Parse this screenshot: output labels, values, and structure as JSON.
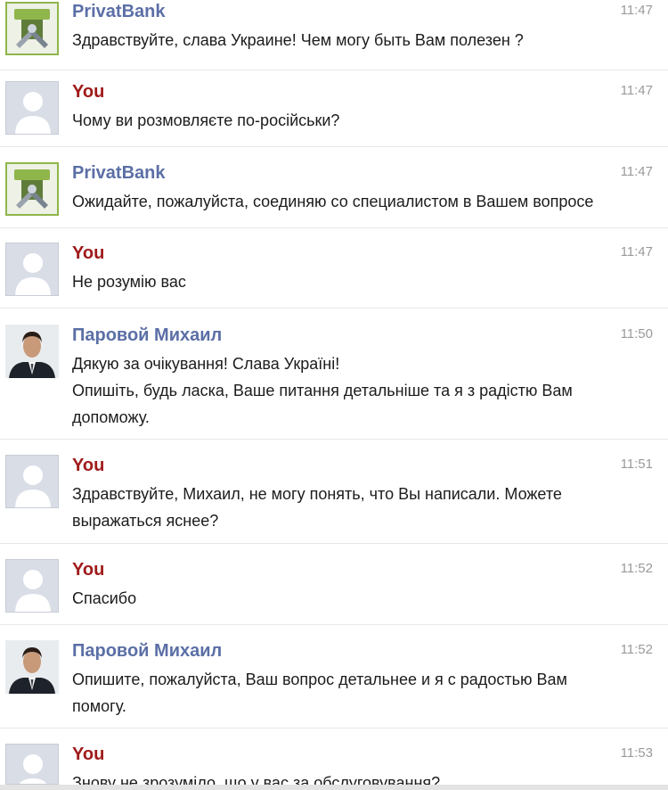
{
  "messages": [
    {
      "sender": "PrivatBank",
      "type": "bank",
      "time": "11:47",
      "lines": [
        "Здравствуйте, слава Украине! Чем могу быть Вам полезен ?"
      ]
    },
    {
      "sender": "You",
      "type": "user",
      "time": "11:47",
      "lines": [
        "Чому ви розмовляєте по-російськи?"
      ]
    },
    {
      "sender": "PrivatBank",
      "type": "bank",
      "time": "11:47",
      "lines": [
        "Ожидайте, пожалуйста, соединяю со специалистом в Вашем вопросе"
      ]
    },
    {
      "sender": "You",
      "type": "user",
      "time": "11:47",
      "lines": [
        "Не розумію вас"
      ]
    },
    {
      "sender": "Паровой Михаил",
      "type": "agent",
      "time": "11:50",
      "lines": [
        "Дякую за очікування! Слава Україні!",
        "Опишіть, будь ласка, Ваше питання детальніше та я з радістю Вам",
        "допоможу."
      ]
    },
    {
      "sender": "You",
      "type": "user",
      "time": "11:51",
      "lines": [
        "Здравствуйте, Михаил, не могу понять, что Вы написали. Можете",
        "выражаться яснее?"
      ]
    },
    {
      "sender": "You",
      "type": "user",
      "time": "11:52",
      "lines": [
        "Спасибо"
      ]
    },
    {
      "sender": "Паровой Михаил",
      "type": "agent",
      "time": "11:52",
      "lines": [
        "Опишите, пожалуйста, Ваш вопрос детальнее и я с радостью Вам",
        "помогу."
      ]
    },
    {
      "sender": "You",
      "type": "user",
      "time": "11:53",
      "lines": [
        "Знову не зрозуміло, що у вас за обслуговування?"
      ]
    }
  ],
  "icons": {
    "bank": "privatbank-tools-icon",
    "user": "default-user-silhouette-icon",
    "agent": "agent-photo-avatar"
  },
  "colors": {
    "bank_name": "#5b6fa6",
    "agent_name": "#5b6fa6",
    "user_name": "#a01a1a",
    "bank_avatar_border": "#8fb64a"
  }
}
